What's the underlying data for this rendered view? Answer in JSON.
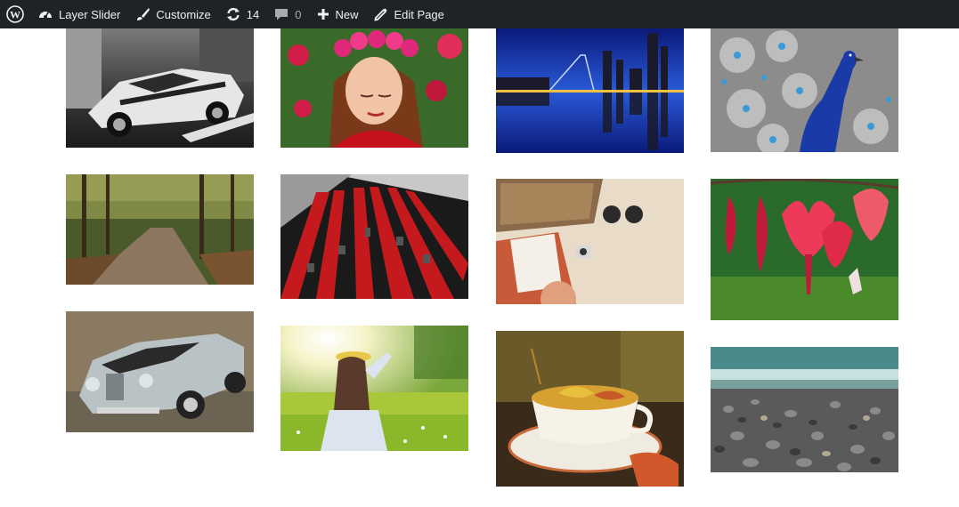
{
  "adminbar": {
    "wp_icon": "wordpress-logo-icon",
    "site_name": "Layer Slider",
    "site_icon": "dashboard-icon",
    "customize_label": "Customize",
    "customize_icon": "paintbrush-icon",
    "updates_count": "14",
    "updates_icon": "refresh-icon",
    "comments_count": "0",
    "comments_icon": "comment-bubble-icon",
    "new_label": "New",
    "new_icon": "plus-icon",
    "edit_label": "Edit Page",
    "edit_icon": "pencil-icon"
  },
  "gallery": {
    "images": [
      {
        "subject": "black-and-white sports car"
      },
      {
        "subject": "girl with flower crown"
      },
      {
        "subject": "city skyline reflection at night"
      },
      {
        "subject": "peacock with spread feathers"
      },
      {
        "subject": "forest dirt road in autumn"
      },
      {
        "subject": "red and black building facade"
      },
      {
        "subject": "flat lay of bag, sunglasses and camera"
      },
      {
        "subject": "red bleeding heart flowers"
      },
      {
        "subject": "vintage silver convertible car"
      },
      {
        "subject": "woman sitting in sunny meadow"
      },
      {
        "subject": "teacup with autumn leaves"
      },
      {
        "subject": "pebble beach with sea waves"
      }
    ]
  }
}
